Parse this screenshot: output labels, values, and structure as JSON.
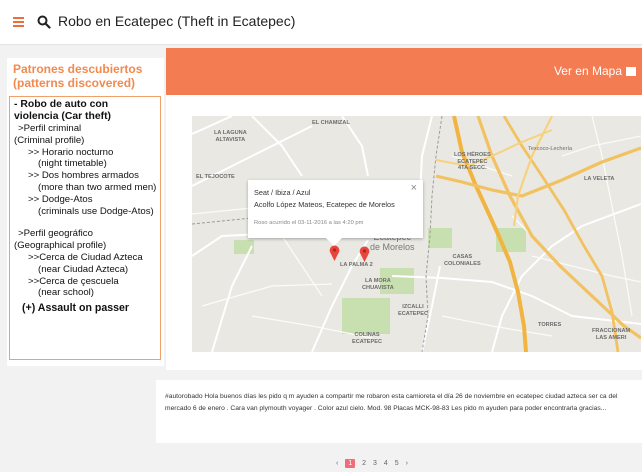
{
  "header": {
    "search_query": "Robo en Ecatepec (Theft in Ecatepec)",
    "menu_icon": "hamburger-menu-icon",
    "search_icon": "magnifier-icon",
    "accent_color": "#f26b3a"
  },
  "sidebar": {
    "title_line1": "Patrones descubiertos",
    "title_line2": "(patterns discovered)",
    "pattern": {
      "title_line1": "- Robo de auto con",
      "title_line2": "violencia (Car theft)",
      "criminal_profile_es": ">Perfil criminal",
      "criminal_profile_en": "(Criminal profile)",
      "items_criminal": [
        {
          "es": ">> Horario nocturno",
          "en": "(night timetable)"
        },
        {
          "es": ">> Dos hombres armados",
          "en": "(more than two armed men)"
        },
        {
          "es": ">> Dodge-Atos",
          "en": "(criminals use Dodge-Atos)"
        }
      ],
      "geo_profile_es": ">Perfil geográfico",
      "geo_profile_en": "(Geographical profile)",
      "items_geo": [
        {
          "es": ">>Cerca de Ciudad Azteca",
          "en": "(near Ciudad Azteca)"
        },
        {
          "es": ">>Cerca de çescuela",
          "en": "(near school)"
        }
      ]
    },
    "extra_pattern": "(+) Assault on passer"
  },
  "banner": {
    "map_link": "Ver en Mapa",
    "color": "#f47c52"
  },
  "map": {
    "popup": {
      "line1": "Seat / Ibiza / Azul",
      "line2": "Acolfo López Mateos, Ecatepec de Morelos",
      "line3": "Roso acurrido el 03-11-2016 a las 4:20 pm",
      "close": "×"
    },
    "labels": {
      "el_chamizal": "EL CHAMIZAL",
      "la_laguna_1": "LA LAGUNA",
      "la_laguna_2": "ALTAVISTA",
      "el_tejocote": "EL TEJOCOTE",
      "los_heroes_1": "LOS HÉROES",
      "los_heroes_2": "ECATEPEC",
      "los_heroes_3": "4TA SECC.",
      "texcoco": "Texcoco-Lechería",
      "la_veleta": "LA VELETA",
      "ecatepec_1": "Ecatepec",
      "ecatepec_2": "de Morelos",
      "la_palma": "LA PALMA 2",
      "casas_1": "CASAS",
      "casas_2": "COLONIALES",
      "la_mora_1": "LA MORA",
      "la_mora_2": "CHUAVISTA",
      "izcalli_1": "IZCALLI",
      "izcalli_2": "ECATEPEC",
      "colinas_1": "COLINAS",
      "colinas_2": "ECATEPEC",
      "torres": "TORRES",
      "fracc_1": "FRACCIONAM",
      "fracc_2": "LAS AMERI"
    }
  },
  "post": {
    "text": "#autorobado Hola buenos días les pido q m ayuden a compartir me robaron esta camioreta el día 26 de noviembre en ecatepec ciudad azteca ser ca del mercado 6 de enero . Cara van plymouth voyager . Color azul cielo. Mod. 98 Placas MCK-98-83 Les pido m ayuden para poder encontrarla gracias..."
  },
  "pager": {
    "prev": "‹",
    "pages": [
      "1",
      "2",
      "3",
      "4",
      "5"
    ],
    "next": "›"
  }
}
